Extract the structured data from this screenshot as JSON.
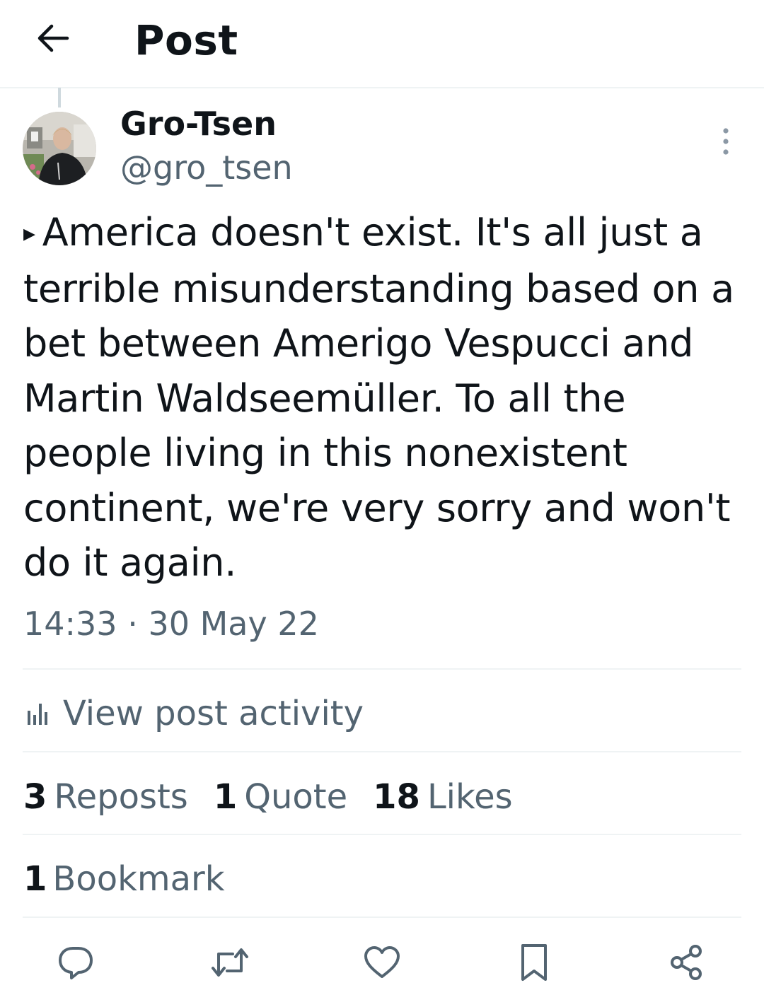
{
  "header": {
    "title": "Post",
    "back_icon": "arrow-left-icon"
  },
  "author": {
    "display_name": "Gro-Tsen",
    "handle": "@gro_tsen"
  },
  "post": {
    "marker": "▸",
    "text": "America doesn't exist. It's all just a terrible misunderstanding based on a bet between Amerigo Vespucci and Martin Waldseemüller. To all the people living in this nonexistent continent, we're very sorry and won't do it again.",
    "time": "14:33",
    "separator": "·",
    "date": "30 May 22"
  },
  "activity": {
    "label": "View post activity",
    "icon": "bar-chart-icon"
  },
  "stats": {
    "reposts_count": "3",
    "reposts_label": "Reposts",
    "quotes_count": "1",
    "quotes_label": "Quote",
    "likes_count": "18",
    "likes_label": "Likes",
    "bookmarks_count": "1",
    "bookmarks_label": "Bookmark"
  },
  "actions": [
    "reply-icon",
    "repost-icon",
    "like-icon",
    "bookmark-icon",
    "share-icon"
  ],
  "colors": {
    "text": "#0f1419",
    "secondary": "#536471",
    "divider": "#eff3f4"
  }
}
